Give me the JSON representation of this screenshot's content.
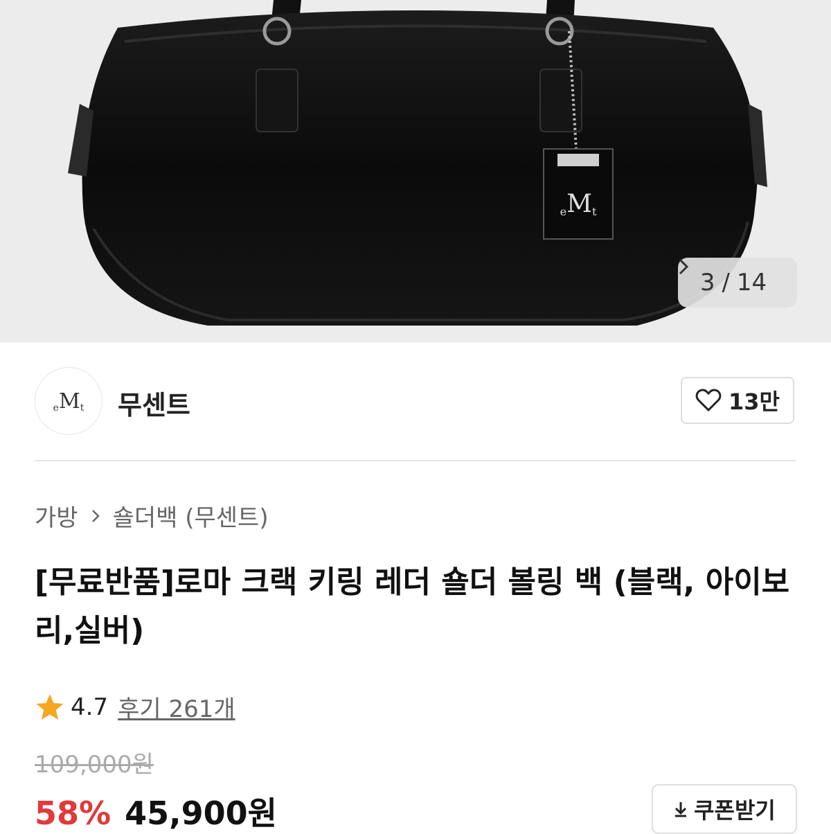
{
  "gallery": {
    "current": "3",
    "separator": "/",
    "total": "14",
    "tag_mark": "M",
    "tag_left": "e",
    "tag_right": "t"
  },
  "brand": {
    "logo_text_left": "e",
    "logo_text_mid": "M",
    "logo_text_right": "t",
    "name": "무센트",
    "likes": "13만"
  },
  "breadcrumb": {
    "category": "가방",
    "subcategory": "숄더백 (무센트)"
  },
  "product": {
    "title": "[무료반품]로마 크랙 키링 레더 숄더 볼링 백 (블랙, 아이보리,실버)",
    "rating": "4.7",
    "reviews": "후기 261개",
    "original_price": "109,000원",
    "discount": "58%",
    "sale_price": "45,900원",
    "coupon_label": "쿠폰받기"
  },
  "colors": {
    "discount": "#e03a3a",
    "star": "#f5a623"
  }
}
